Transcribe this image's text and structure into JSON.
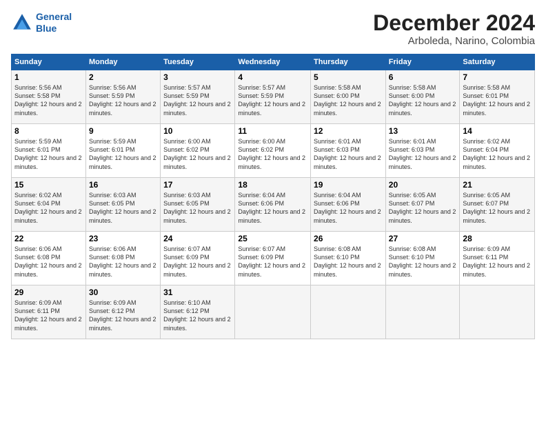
{
  "logo": {
    "line1": "General",
    "line2": "Blue"
  },
  "title": "December 2024",
  "subtitle": "Arboleda, Narino, Colombia",
  "days_header": [
    "Sunday",
    "Monday",
    "Tuesday",
    "Wednesday",
    "Thursday",
    "Friday",
    "Saturday"
  ],
  "weeks": [
    [
      {
        "day": "1",
        "sunrise": "5:56 AM",
        "sunset": "5:58 PM",
        "daylight": "12 hours and 2 minutes."
      },
      {
        "day": "2",
        "sunrise": "5:56 AM",
        "sunset": "5:59 PM",
        "daylight": "12 hours and 2 minutes."
      },
      {
        "day": "3",
        "sunrise": "5:57 AM",
        "sunset": "5:59 PM",
        "daylight": "12 hours and 2 minutes."
      },
      {
        "day": "4",
        "sunrise": "5:57 AM",
        "sunset": "5:59 PM",
        "daylight": "12 hours and 2 minutes."
      },
      {
        "day": "5",
        "sunrise": "5:58 AM",
        "sunset": "6:00 PM",
        "daylight": "12 hours and 2 minutes."
      },
      {
        "day": "6",
        "sunrise": "5:58 AM",
        "sunset": "6:00 PM",
        "daylight": "12 hours and 2 minutes."
      },
      {
        "day": "7",
        "sunrise": "5:58 AM",
        "sunset": "6:01 PM",
        "daylight": "12 hours and 2 minutes."
      }
    ],
    [
      {
        "day": "8",
        "sunrise": "5:59 AM",
        "sunset": "6:01 PM",
        "daylight": "12 hours and 2 minutes."
      },
      {
        "day": "9",
        "sunrise": "5:59 AM",
        "sunset": "6:01 PM",
        "daylight": "12 hours and 2 minutes."
      },
      {
        "day": "10",
        "sunrise": "6:00 AM",
        "sunset": "6:02 PM",
        "daylight": "12 hours and 2 minutes."
      },
      {
        "day": "11",
        "sunrise": "6:00 AM",
        "sunset": "6:02 PM",
        "daylight": "12 hours and 2 minutes."
      },
      {
        "day": "12",
        "sunrise": "6:01 AM",
        "sunset": "6:03 PM",
        "daylight": "12 hours and 2 minutes."
      },
      {
        "day": "13",
        "sunrise": "6:01 AM",
        "sunset": "6:03 PM",
        "daylight": "12 hours and 2 minutes."
      },
      {
        "day": "14",
        "sunrise": "6:02 AM",
        "sunset": "6:04 PM",
        "daylight": "12 hours and 2 minutes."
      }
    ],
    [
      {
        "day": "15",
        "sunrise": "6:02 AM",
        "sunset": "6:04 PM",
        "daylight": "12 hours and 2 minutes."
      },
      {
        "day": "16",
        "sunrise": "6:03 AM",
        "sunset": "6:05 PM",
        "daylight": "12 hours and 2 minutes."
      },
      {
        "day": "17",
        "sunrise": "6:03 AM",
        "sunset": "6:05 PM",
        "daylight": "12 hours and 2 minutes."
      },
      {
        "day": "18",
        "sunrise": "6:04 AM",
        "sunset": "6:06 PM",
        "daylight": "12 hours and 2 minutes."
      },
      {
        "day": "19",
        "sunrise": "6:04 AM",
        "sunset": "6:06 PM",
        "daylight": "12 hours and 2 minutes."
      },
      {
        "day": "20",
        "sunrise": "6:05 AM",
        "sunset": "6:07 PM",
        "daylight": "12 hours and 2 minutes."
      },
      {
        "day": "21",
        "sunrise": "6:05 AM",
        "sunset": "6:07 PM",
        "daylight": "12 hours and 2 minutes."
      }
    ],
    [
      {
        "day": "22",
        "sunrise": "6:06 AM",
        "sunset": "6:08 PM",
        "daylight": "12 hours and 2 minutes."
      },
      {
        "day": "23",
        "sunrise": "6:06 AM",
        "sunset": "6:08 PM",
        "daylight": "12 hours and 2 minutes."
      },
      {
        "day": "24",
        "sunrise": "6:07 AM",
        "sunset": "6:09 PM",
        "daylight": "12 hours and 2 minutes."
      },
      {
        "day": "25",
        "sunrise": "6:07 AM",
        "sunset": "6:09 PM",
        "daylight": "12 hours and 2 minutes."
      },
      {
        "day": "26",
        "sunrise": "6:08 AM",
        "sunset": "6:10 PM",
        "daylight": "12 hours and 2 minutes."
      },
      {
        "day": "27",
        "sunrise": "6:08 AM",
        "sunset": "6:10 PM",
        "daylight": "12 hours and 2 minutes."
      },
      {
        "day": "28",
        "sunrise": "6:09 AM",
        "sunset": "6:11 PM",
        "daylight": "12 hours and 2 minutes."
      }
    ],
    [
      {
        "day": "29",
        "sunrise": "6:09 AM",
        "sunset": "6:11 PM",
        "daylight": "12 hours and 2 minutes."
      },
      {
        "day": "30",
        "sunrise": "6:09 AM",
        "sunset": "6:12 PM",
        "daylight": "12 hours and 2 minutes."
      },
      {
        "day": "31",
        "sunrise": "6:10 AM",
        "sunset": "6:12 PM",
        "daylight": "12 hours and 2 minutes."
      },
      null,
      null,
      null,
      null
    ]
  ]
}
